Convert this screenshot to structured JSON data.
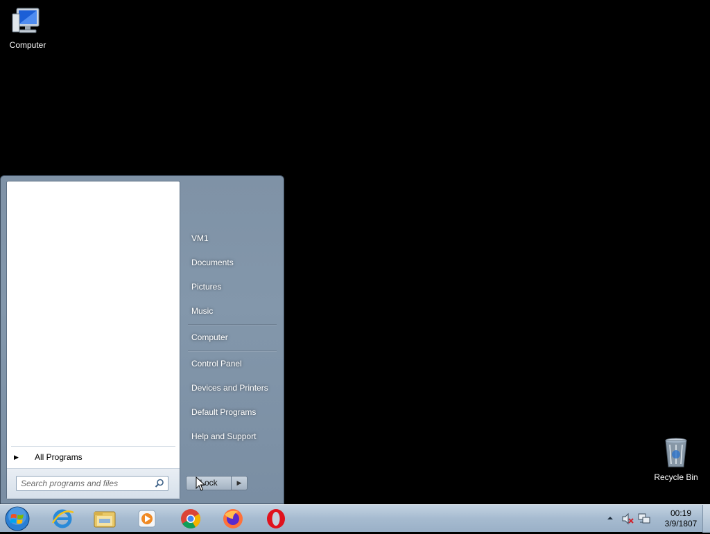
{
  "desktop": {
    "icons": [
      {
        "label": "Computer"
      },
      {
        "label": "Recycle Bin"
      }
    ]
  },
  "start_menu": {
    "all_programs_label": "All Programs",
    "search_placeholder": "Search programs and files",
    "right_items": [
      "VM1",
      "Documents",
      "Pictures",
      "Music",
      "Computer",
      "Control Panel",
      "Devices and Printers",
      "Default Programs",
      "Help and Support"
    ],
    "lock_label": "Lock"
  },
  "taskbar": {
    "pinned": [
      {
        "icon": "internet-explorer-icon"
      },
      {
        "icon": "windows-explorer-icon"
      },
      {
        "icon": "media-player-icon"
      },
      {
        "icon": "chrome-icon"
      },
      {
        "icon": "firefox-icon"
      },
      {
        "icon": "opera-icon"
      }
    ],
    "clock": {
      "time": "00:19",
      "date": "3/9/1807"
    }
  }
}
